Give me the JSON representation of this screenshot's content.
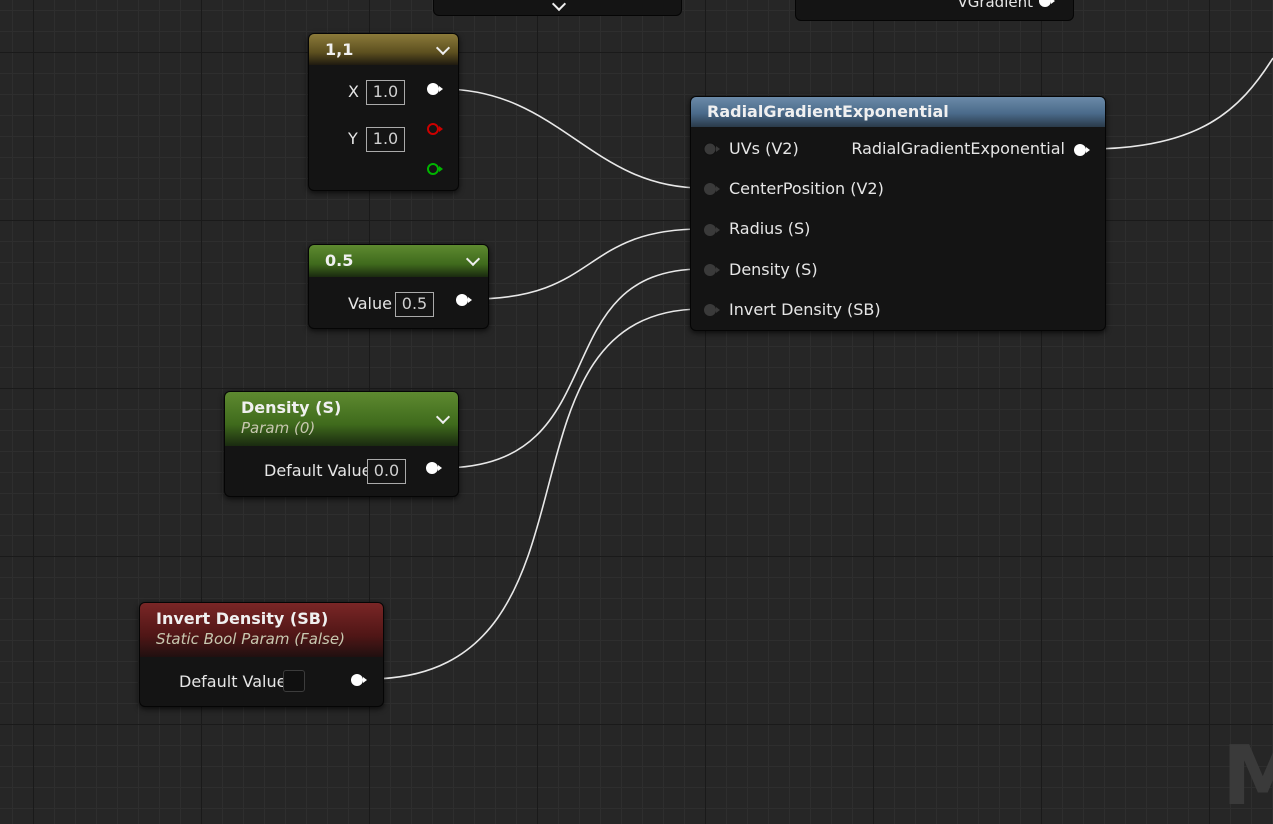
{
  "canvas": {
    "watermark_text": "M",
    "colors": {
      "background": "#262626",
      "wire": "#e8e8e8",
      "pin_white": "#ffffff",
      "pin_red": "#cc0000",
      "pin_green": "#00b400"
    }
  },
  "partial_nodes": {
    "top_right_output_label": "VGradient"
  },
  "nodes": {
    "vector2": {
      "title": "1,1",
      "x_label": "X",
      "x_value": "1.0",
      "y_label": "Y",
      "y_value": "1.0"
    },
    "scalar": {
      "title": "0.5",
      "value_label": "Value",
      "value": "0.5"
    },
    "density_param": {
      "title": "Density (S)",
      "subtitle": "Param (0)",
      "default_label": "Default Value",
      "default_value": "0.0"
    },
    "invert_density": {
      "title": "Invert Density (SB)",
      "subtitle": "Static Bool Param (False)",
      "default_label": "Default Value"
    },
    "radial_gradient": {
      "title": "RadialGradientExponential",
      "inputs": [
        "UVs (V2)",
        "CenterPosition (V2)",
        "Radius (S)",
        "Density (S)",
        "Invert Density (SB)"
      ],
      "output": "RadialGradientExponential"
    }
  }
}
